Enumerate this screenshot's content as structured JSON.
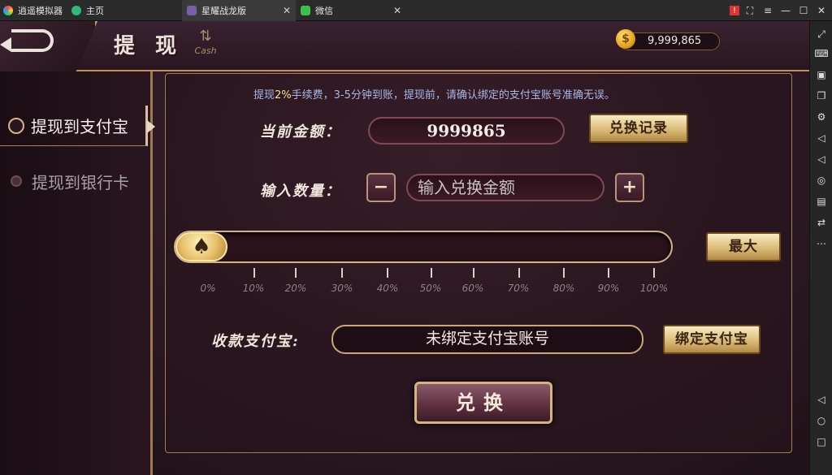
{
  "tabs": [
    {
      "label": "逍遥模拟器",
      "icon": "emulator-logo-icon"
    },
    {
      "label": "主页",
      "icon": "home-icon"
    },
    {
      "label": "星耀战龙版",
      "icon": "game-icon",
      "active": true
    },
    {
      "label": "微信",
      "icon": "wechat-icon"
    }
  ],
  "header": {
    "title": "提 现",
    "cash_icon_text": "Cash",
    "balance": "9,999,865"
  },
  "menu": {
    "items": [
      {
        "label": "提现到支付宝",
        "active": true
      },
      {
        "label": "提现到银行卡",
        "active": false
      }
    ]
  },
  "notice": {
    "prefix": "提现",
    "highlight": "2%",
    "suffix": "手续费，3-5分钟到账，提现前，请确认绑定的支付宝账号准确无误。"
  },
  "form": {
    "current_label": "当前金额：",
    "current_amount": "9999865",
    "record_button": "兑换记录",
    "quantity_label": "输入数量：",
    "minus": "−",
    "plus": "+",
    "quantity_placeholder": "输入兑换金额",
    "max_button": "最大",
    "slider_value": 0,
    "slider_ticks": [
      "0%",
      "10%",
      "20%",
      "30%",
      "40%",
      "50%",
      "60%",
      "70%",
      "80%",
      "90%",
      "100%"
    ],
    "alipay_label": "收款支付宝:",
    "alipay_account": "未绑定支付宝账号",
    "bind_button": "绑定支付宝",
    "submit_button": "兑换"
  },
  "colors": {
    "gold": "#d8b773",
    "background": "#2f1a26",
    "notice": "#a6b9e6"
  }
}
